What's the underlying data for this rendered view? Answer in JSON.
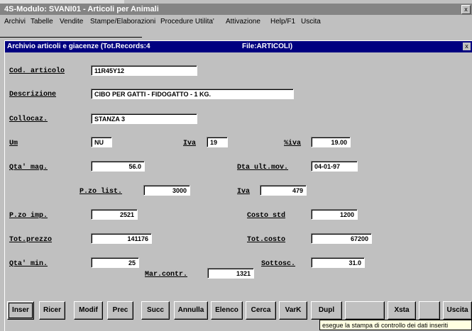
{
  "app": {
    "title": "4S-Modulo: SVANI01 - Articoli per Animali",
    "close_glyph": "x"
  },
  "menu": [
    "Archivi",
    "Tabelle",
    "Vendite",
    "Stampe/Elaborazioni",
    "Procedure Utilita'",
    "Attivazione",
    "Help/F1",
    "Uscita"
  ],
  "child": {
    "title": "Archivio articoli e giacenze (Tot.Records:4",
    "file_label": "File:ARTICOLI)",
    "close_glyph": "x"
  },
  "form": {
    "cod_articolo": {
      "label": "Cod. articolo",
      "value": "11R45Y12"
    },
    "descrizione": {
      "label": "Descrizione",
      "value": "CIBO PER GATTI - FIDOGATTO - 1 KG."
    },
    "collocaz": {
      "label": "Collocaz.",
      "value": "STANZA 3"
    },
    "um": {
      "label": "Um",
      "value": "NU"
    },
    "iva": {
      "label": "Iva",
      "value": "19"
    },
    "aliva": {
      "label": "%iva",
      "value": "19.00"
    },
    "qta_mag": {
      "label": "Qta' mag.",
      "value": "56.0"
    },
    "dta_ult_mov": {
      "label": "Dta ult.mov.",
      "value": "04-01-97"
    },
    "pzo_list": {
      "label": "P.zo list.",
      "value": "3000"
    },
    "iva_list": {
      "label": "Iva",
      "value": "479"
    },
    "pzo_imp": {
      "label": "P.zo imp.",
      "value": "2521"
    },
    "costo_std": {
      "label": "Costo std",
      "value": "1200"
    },
    "tot_prezzo": {
      "label": "Tot.prezzo",
      "value": "141176"
    },
    "tot_costo": {
      "label": "Tot.costo",
      "value": "67200"
    },
    "qta_min": {
      "label": "Qta' min.",
      "value": "25"
    },
    "sottosc": {
      "label": "Sottosc.",
      "value": "31.0"
    },
    "mar_contr": {
      "label": "Mar.contr.",
      "value": "1321"
    }
  },
  "buttons": [
    "Inser",
    "Ricer",
    "Modif",
    "Prec",
    "Succ",
    "Annulla",
    "Elenco",
    "Cerca",
    "VarK",
    "Dupl",
    "",
    "Xsta",
    "",
    "Uscita"
  ],
  "tooltip": "esegue la stampa di controllo dei dati inseriti"
}
